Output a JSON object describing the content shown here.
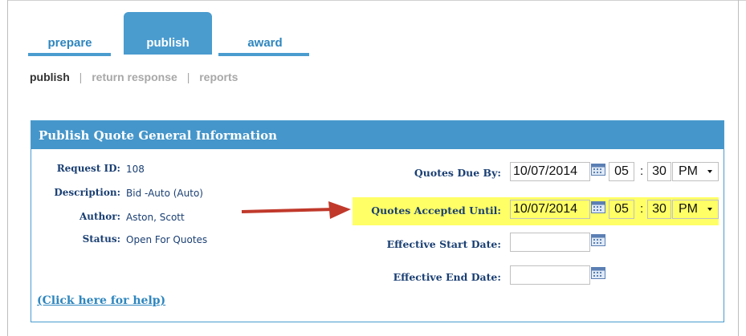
{
  "tabs": [
    {
      "label": "prepare"
    },
    {
      "label": "publish"
    },
    {
      "label": "award"
    }
  ],
  "subnav": {
    "items": [
      "publish",
      "return response",
      "reports"
    ],
    "separator": "|"
  },
  "panel": {
    "title": "Publish Quote General Information",
    "info": [
      {
        "label": "Request ID:",
        "value": "108"
      },
      {
        "label": "Description:",
        "value": "Bid -Auto (Auto)"
      },
      {
        "label": "Author:",
        "value": "Aston, Scott"
      },
      {
        "label": "Status:",
        "value": "Open For Quotes"
      }
    ],
    "dates": [
      {
        "label": "Quotes Due By:",
        "date": "10/07/2014",
        "hour": "05",
        "minute": "30",
        "ampm": "PM"
      },
      {
        "label": "Quotes Accepted Until:",
        "date": "10/07/2014",
        "hour": "05",
        "minute": "30",
        "ampm": "PM"
      },
      {
        "label": "Effective Start Date:",
        "date": ""
      },
      {
        "label": "Effective End Date:",
        "date": ""
      }
    ],
    "time_separator": ":",
    "help": "(Click here for help)"
  },
  "colors": {
    "accent": "#4a9ccf",
    "highlight": "#ffff66",
    "arrow": "#c0392b",
    "label": "#1a3f73"
  },
  "icons": [
    "calendar-icon",
    "dropdown-caret-icon",
    "red-arrow-icon"
  ]
}
